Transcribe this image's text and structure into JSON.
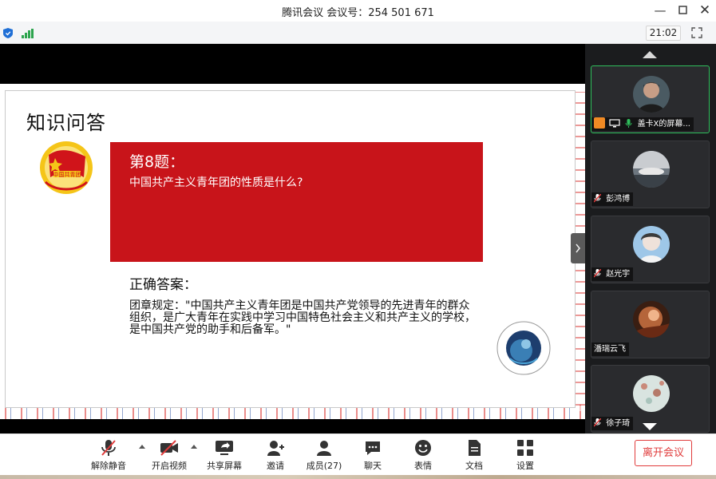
{
  "window": {
    "title": "腾讯会议 会议号：254 501 671",
    "clock": "21:02"
  },
  "slide": {
    "title": "知识问答",
    "question_number": "第8题：",
    "question_text": "中国共产主义青年团的性质是什么?",
    "answer_title": "正确答案：",
    "answer_body": "团章规定：\"中国共产主义青年团是中国共产党领导的先进青年的群众组织，是广大青年在实践中学习中国特色社会主义和共产主义的学校，是中国共产党的助手和后备军。\""
  },
  "participants": [
    {
      "name": "盖卡X的屏幕...",
      "active": true,
      "mic_muted": false,
      "host": true,
      "sharing": true
    },
    {
      "name": "彭鸿博",
      "active": false,
      "mic_muted": true
    },
    {
      "name": "赵光宇",
      "active": false,
      "mic_muted": true
    },
    {
      "name": "潘瑞云飞",
      "active": false,
      "mic_muted": false
    },
    {
      "name": "徐子琦",
      "active": false,
      "mic_muted": true
    }
  ],
  "toolbar": {
    "unmute": "解除静音",
    "start_video": "开启视频",
    "share_screen": "共享屏幕",
    "invite": "邀请",
    "members": "成员(27)",
    "chat": "聊天",
    "reactions": "表情",
    "docs": "文档",
    "settings": "设置",
    "leave": "离开会议"
  },
  "colors": {
    "accent_red": "#c8141a",
    "active_border": "#2fbf5c",
    "leave_red": "#e03b3b",
    "signal_green": "#2da44e"
  }
}
